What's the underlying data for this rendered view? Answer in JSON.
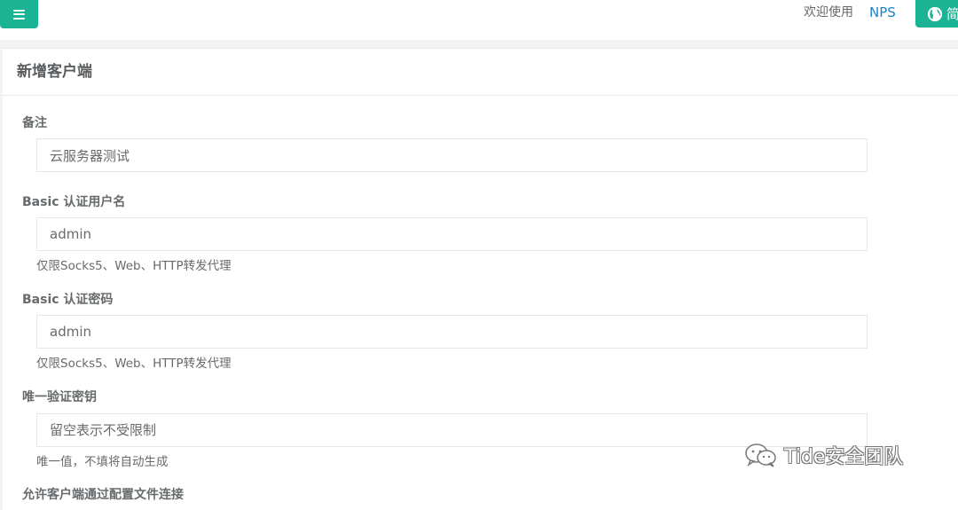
{
  "header": {
    "welcome_text": "欢迎使用",
    "brand_link": "NPS",
    "language_button": "简"
  },
  "panel": {
    "title": "新增客户端"
  },
  "form": {
    "remark": {
      "label": "备注",
      "value": "云服务器测试"
    },
    "basic_username": {
      "label": "Basic 认证用户名",
      "value": "admin",
      "help": "仅限Socks5、Web、HTTP转发代理"
    },
    "basic_password": {
      "label": "Basic 认证密码",
      "value": "admin",
      "help": "仅限Socks5、Web、HTTP转发代理"
    },
    "vkey": {
      "label": "唯一验证密钥",
      "placeholder": "留空表示不受限制",
      "help": "唯一值，不填将自动生成"
    },
    "allow_config_conn": {
      "label": "允许客户端通过配置文件连接"
    }
  },
  "watermark": {
    "text": "Tide安全团队",
    "icon": "wechat-icon"
  },
  "colors": {
    "accent": "#1ab394",
    "link": "#1c84c6"
  }
}
